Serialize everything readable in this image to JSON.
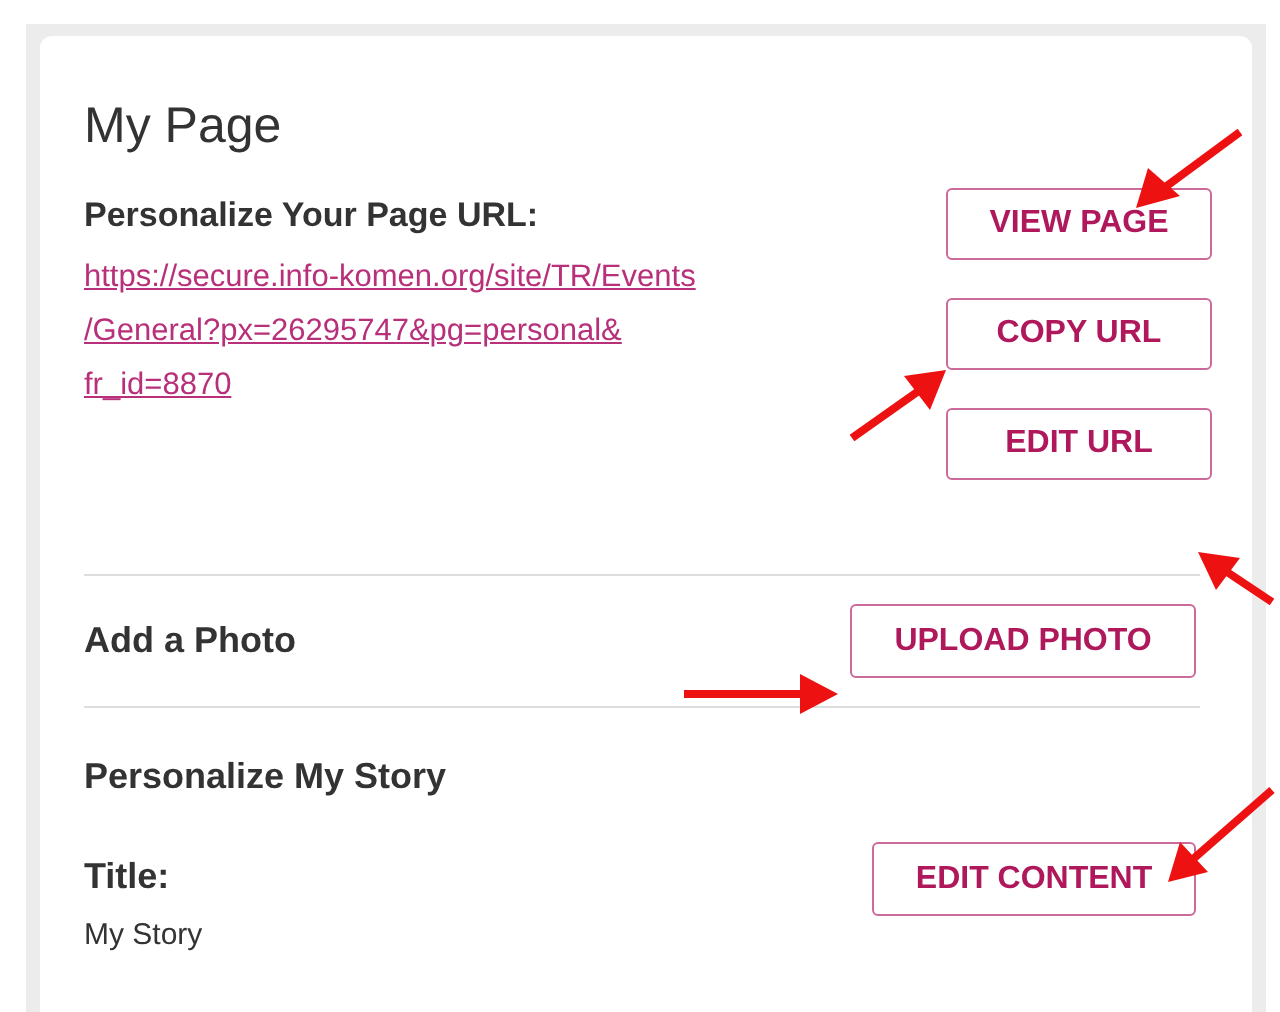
{
  "title": "My Page",
  "url_section": {
    "label": "Personalize Your Page URL:",
    "url_lines": [
      "https://secure.info-komen.org/site/TR/Events",
      "/General?px=26295747&pg=personal&",
      "fr_id=8870"
    ],
    "buttons": [
      "VIEW PAGE",
      "COPY URL",
      "EDIT URL"
    ]
  },
  "photo_section": {
    "label": "Add a Photo",
    "button": "UPLOAD PHOTO"
  },
  "story_section": {
    "heading": "Personalize My Story",
    "title_label": "Title:",
    "title_value": "My Story",
    "button": "EDIT CONTENT"
  }
}
